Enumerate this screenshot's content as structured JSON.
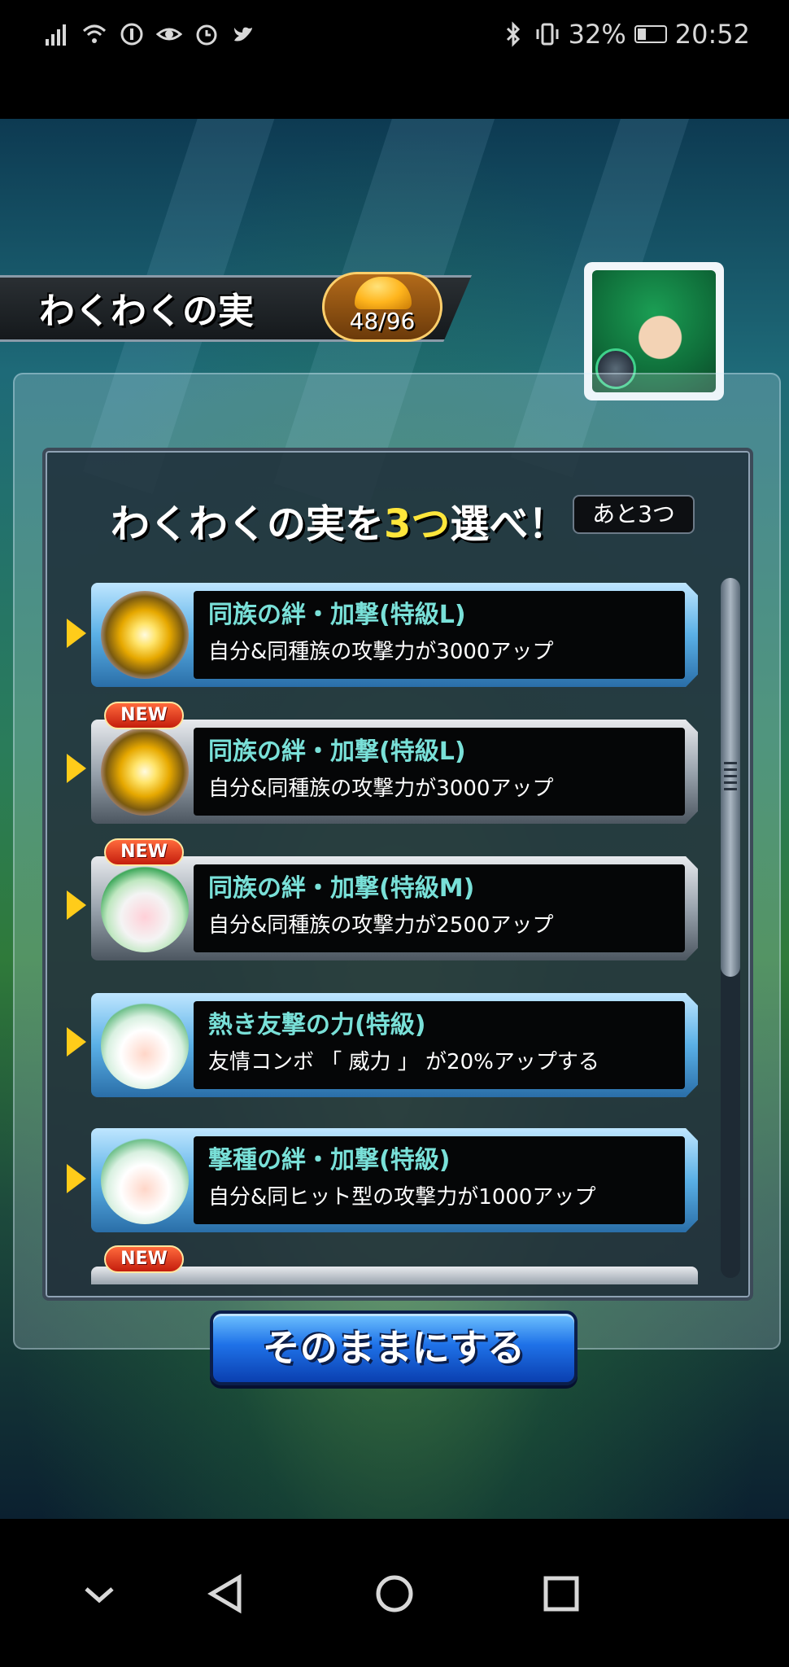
{
  "status_bar": {
    "battery_percent": "32%",
    "time": "20:52",
    "icons": [
      "signal-icon",
      "wifi-icon",
      "data-saver-icon",
      "eye-icon",
      "alarm-icon",
      "twitter-icon",
      "bluetooth-icon",
      "vibrate-icon",
      "battery-icon"
    ]
  },
  "header": {
    "title": "わくわくの実",
    "counter": "48/96",
    "counter_icon": "helmet-icon",
    "portrait_icon": "character-portrait-icon"
  },
  "panel": {
    "heading_pre": "わくわくの実を",
    "heading_highlight": "3つ",
    "heading_post": "選べ！",
    "remaining": "あと3つ"
  },
  "items": [
    {
      "title": "同族の絆・加撃(特級L)",
      "desc": "自分&同種族の攻撃力が3000アップ",
      "new": false,
      "icon": "golden-fruit-icon"
    },
    {
      "title": "同族の絆・加撃(特級L)",
      "desc": "自分&同種族の攻撃力が3000アップ",
      "new": true,
      "icon": "golden-fruit-icon"
    },
    {
      "title": "同族の絆・加撃(特級M)",
      "desc": "自分&同種族の攻撃力が2500アップ",
      "new": true,
      "icon": "green-fruit-icon"
    },
    {
      "title": "熱き友撃の力(特級)",
      "desc": "友情コンボ 「 威力 」 が20%アップする",
      "new": false,
      "icon": "white-fruit-icon"
    },
    {
      "title": "撃種の絆・加撃(特級)",
      "desc": "自分&同ヒット型の攻撃力が1000アップ",
      "new": false,
      "icon": "white-fruit-icon"
    }
  ],
  "new_badge_label": "NEW",
  "keep_button_label": "そのままにする",
  "colors": {
    "highlight": "#ffe63b",
    "item_title": "#79e0d8",
    "selected_frame": "#5ab0e6",
    "button_blue": "#1f72e8"
  }
}
